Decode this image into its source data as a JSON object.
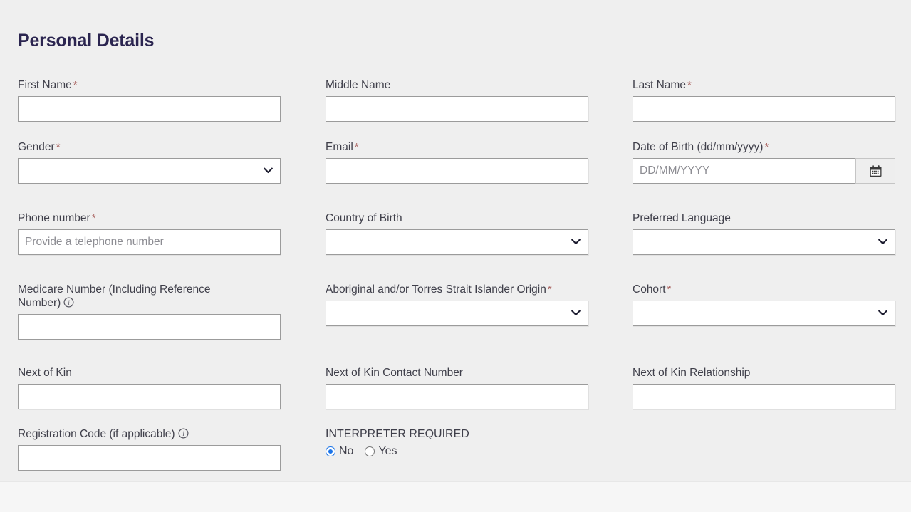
{
  "page": {
    "title": "Personal Details",
    "background_color": "#efefef",
    "title_color": "#2b2550",
    "required_marker": "*",
    "required_marker_color": "#a8615e",
    "accent_color": "#1a73e8",
    "field_border_color": "#9b9b9b"
  },
  "fields": {
    "first_name": {
      "label": "First Name",
      "required": "*",
      "value": "",
      "placeholder": "",
      "type": "text"
    },
    "middle_name": {
      "label": "Middle Name",
      "required": "",
      "value": "",
      "placeholder": "",
      "type": "text"
    },
    "last_name": {
      "label": "Last Name",
      "required": "*",
      "value": "",
      "placeholder": "",
      "type": "text"
    },
    "gender": {
      "label": "Gender",
      "required": "*",
      "value": "",
      "type": "select",
      "options": [
        ""
      ]
    },
    "email": {
      "label": "Email",
      "required": "*",
      "value": "",
      "placeholder": "",
      "type": "text"
    },
    "date_of_birth": {
      "label": "Date of Birth (dd/mm/yyyy)",
      "required": "*",
      "value": "",
      "placeholder": "DD/MM/YYYY",
      "type": "date",
      "button_icon": "calendar-icon"
    },
    "phone_number": {
      "label": "Phone number",
      "required": "*",
      "value": "",
      "placeholder": "Provide a telephone number",
      "type": "text"
    },
    "country_of_birth": {
      "label": "Country of Birth",
      "required": "",
      "value": "",
      "type": "select",
      "options": [
        ""
      ]
    },
    "preferred_language": {
      "label": "Preferred Language",
      "required": "",
      "value": "",
      "type": "select",
      "options": [
        ""
      ]
    },
    "medicare_number": {
      "label": "Medicare Number (Including Reference Number)",
      "required": "",
      "info_icon": "info-icon",
      "value": "",
      "placeholder": "",
      "type": "text"
    },
    "aboriginal_origin": {
      "label": "Aboriginal and/or Torres Strait Islander Origin",
      "required": "*",
      "value": "",
      "type": "select",
      "options": [
        ""
      ]
    },
    "cohort": {
      "label": "Cohort",
      "required": "*",
      "value": "",
      "type": "select",
      "options": [
        ""
      ]
    },
    "next_of_kin": {
      "label": "Next of Kin",
      "required": "",
      "value": "",
      "placeholder": "",
      "type": "text"
    },
    "next_of_kin_contact_number": {
      "label": "Next of Kin Contact Number",
      "required": "",
      "value": "",
      "placeholder": "",
      "type": "text"
    },
    "next_of_kin_relationship": {
      "label": "Next of Kin Relationship",
      "required": "",
      "value": "",
      "placeholder": "",
      "type": "text"
    },
    "registration_code": {
      "label": "Registration Code (if applicable)",
      "required": "",
      "info_icon": "info-icon",
      "value": "",
      "placeholder": "",
      "type": "text"
    },
    "interpreter_required": {
      "label": "INTERPRETER REQUIRED",
      "type": "radio",
      "selected": "No",
      "options": [
        {
          "label": "No",
          "selected": true
        },
        {
          "label": "Yes",
          "selected": false
        }
      ]
    }
  }
}
